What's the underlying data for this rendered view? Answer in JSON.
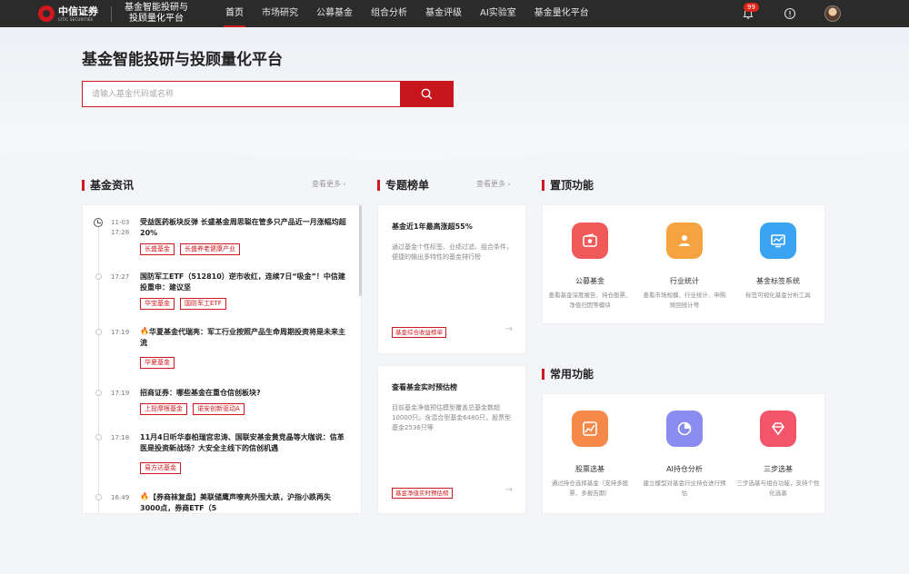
{
  "brand": {
    "logo_cn": "中信证券",
    "logo_en": "CITIC SECURITIES",
    "platform_name": "基金智能投研与投顾量化平台"
  },
  "nav": [
    {
      "label": "首页",
      "active": true
    },
    {
      "label": "市场研究",
      "active": false
    },
    {
      "label": "公募基金",
      "active": false
    },
    {
      "label": "组合分析",
      "active": false
    },
    {
      "label": "基金评级",
      "active": false
    },
    {
      "label": "AI实验室",
      "active": false
    },
    {
      "label": "基金量化平台",
      "active": false
    }
  ],
  "notifications": {
    "count": "99"
  },
  "hero": {
    "title": "基金智能投研与投顾量化平台",
    "search_placeholder": "请输入基金代码或名称"
  },
  "sections": {
    "news": {
      "title": "基金资讯",
      "more": "查看更多"
    },
    "ranking": {
      "title": "专题榜单",
      "more": "查看更多"
    },
    "pinned": {
      "title": "置顶功能"
    },
    "common": {
      "title": "常用功能"
    }
  },
  "news": [
    {
      "date": "11-03",
      "time": "17:28",
      "title": "受益医药板块反弹 长盛基金周思聪在管多只产品近一月涨幅均超20%",
      "hot": false,
      "tags": [
        "长盛基金",
        "长盛养老健康产业"
      ]
    },
    {
      "date": "",
      "time": "17:27",
      "title": "国防军工ETF（512810）逆市收红，连续7日“吸金”！中信建投重申：建议坚",
      "hot": false,
      "tags": [
        "华宝基金",
        "国防军工ETF"
      ]
    },
    {
      "date": "",
      "time": "17:19",
      "title": "华夏基金代瑞亮：军工行业按照产品生命周期投资将是未来主流",
      "hot": true,
      "tags": [
        "华夏基金"
      ]
    },
    {
      "date": "",
      "time": "17:19",
      "title": "招商证券：哪些基金在重仓信创板块?",
      "hot": false,
      "tags": [
        "上投摩根基金",
        "诺安创新驱动A"
      ]
    },
    {
      "date": "",
      "time": "17:18",
      "title": "11月4日听华泰柏瑞宫忠涛、国联安基金黄竞晶等大咖说：信革医是投资新战场？大安全主线下的信创机遇",
      "hot": false,
      "tags": [
        "易方达基金"
      ]
    },
    {
      "date": "",
      "time": "16:49",
      "title": "【券商袜复盘】美联储鹰声嘹亮外围大跌，沪指小跌再失3000点，券商ETF（5",
      "hot": true,
      "tags": []
    }
  ],
  "rankings": [
    {
      "title": "基金近1年最高涨超55%",
      "desc": "通过基金个性标签、业绩过滤、组合条件，便捷的输出多特性的基金排行榜",
      "link": "基金综合收益榜单"
    },
    {
      "title": "查看基金实时预估榜",
      "desc": "目前基金净值预估模型覆盖总基金数超10000只。含混合型基金6480只，股票型基金2536只等",
      "link": "基金净值实时预估榜"
    }
  ],
  "pinned_features": [
    {
      "name": "公募基金",
      "desc": "查看基金深度报告、持仓股票、净值归因等模块",
      "icon": "wallet-icon",
      "color": "#f25a5a"
    },
    {
      "name": "行业统计",
      "desc": "查看市场规模、行业统计、申购赎回统计等",
      "icon": "user-chart-icon",
      "color": "#f5a340"
    },
    {
      "name": "基金标签系统",
      "desc": "标签可视化基金分析工具",
      "icon": "monitor-chart-icon",
      "color": "#3aa3f2"
    }
  ],
  "common_features": [
    {
      "name": "股票选基",
      "desc": "通过持仓选择基金（支持多股票、多报告期）",
      "icon": "trend-chart-icon",
      "color": "#f5894a"
    },
    {
      "name": "AI持仓分析",
      "desc": "建立模型对基金行业持仓进行预估",
      "icon": "pie-chart-icon",
      "color": "#8a8cf0"
    },
    {
      "name": "三步选基",
      "desc": "三步选基与组合功能，支持个性化选基",
      "icon": "diamond-icon",
      "color": "#f2546a"
    }
  ]
}
